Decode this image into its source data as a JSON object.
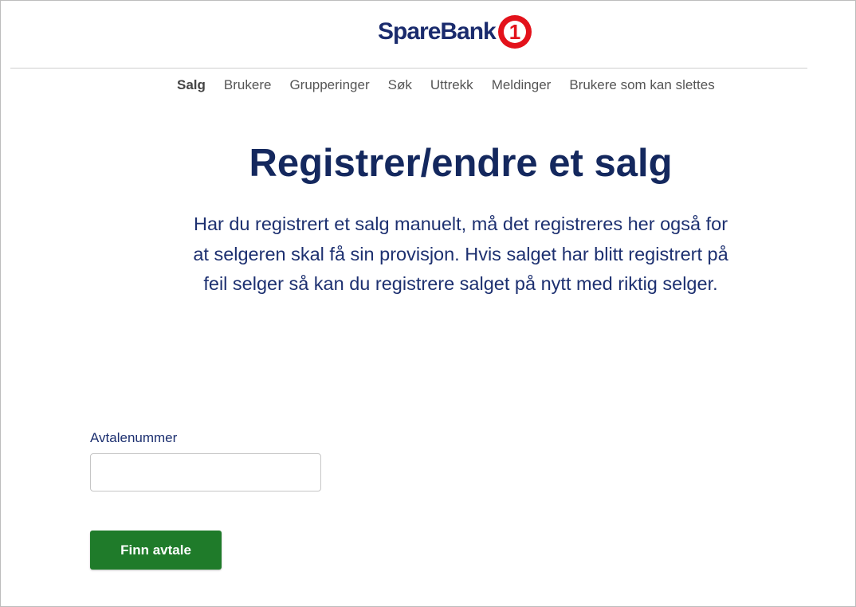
{
  "brand": {
    "name": "SpareBank",
    "badge_number": "1",
    "badge_color": "#e3121b",
    "text_color": "#1a2b6d"
  },
  "nav": {
    "items": [
      {
        "label": "Salg",
        "active": true
      },
      {
        "label": "Brukere",
        "active": false
      },
      {
        "label": "Grupperinger",
        "active": false
      },
      {
        "label": "Søk",
        "active": false
      },
      {
        "label": "Uttrekk",
        "active": false
      },
      {
        "label": "Meldinger",
        "active": false
      },
      {
        "label": "Brukere som kan slettes",
        "active": false
      }
    ]
  },
  "main": {
    "title": "Registrer/endre et salg",
    "intro": "Har du registrert et salg manuelt, må det registreres her også for at selgeren skal få sin provisjon. Hvis salget har blitt registrert på feil selger så kan du registrere salget på nytt med riktig selger."
  },
  "form": {
    "agreement_label": "Avtalenummer",
    "agreement_value": "",
    "agreement_placeholder": "",
    "submit_label": "Finn avtale",
    "submit_color": "#1f7b2a"
  }
}
